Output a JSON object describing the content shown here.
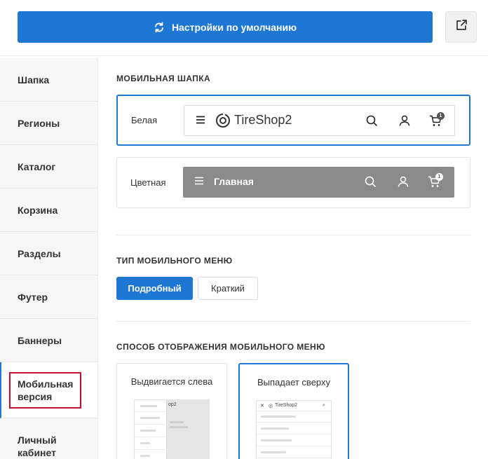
{
  "toolbar": {
    "reset_label": "Настройки по умолчанию",
    "reset_icon": "refresh-icon",
    "share_icon": "share-icon",
    "accent_color": "#1f77d4"
  },
  "sidebar": {
    "items": [
      {
        "label": "Шапка"
      },
      {
        "label": "Регионы"
      },
      {
        "label": "Каталог"
      },
      {
        "label": "Корзина"
      },
      {
        "label": "Разделы"
      },
      {
        "label": "Футер"
      },
      {
        "label": "Баннеры"
      },
      {
        "label": "Мобильная версия",
        "line1": "Мобильная",
        "line2": "версия",
        "active": true
      },
      {
        "label": "Личный кабинет",
        "line1": "Личный",
        "line2": "кабинет"
      }
    ]
  },
  "mobile_header": {
    "title": "МОБИЛЬНАЯ ШАПКА",
    "options": [
      {
        "label": "Белая",
        "selected": true,
        "preview_logo": "TireShop2",
        "cart_count": "1"
      },
      {
        "label": "Цветная",
        "selected": false,
        "preview_title": "Главная",
        "cart_count": "1",
        "color": "#8a8a8a"
      }
    ]
  },
  "menu_type": {
    "title": "ТИП МОБИЛЬНОГО МЕНЮ",
    "options": [
      {
        "label": "Подробный",
        "selected": true
      },
      {
        "label": "Краткий",
        "selected": false
      }
    ]
  },
  "menu_display": {
    "title": "СПОСОБ ОТОБРАЖЕНИЯ МОБИЛЬНОГО МЕНЮ",
    "options": [
      {
        "label": "Выдвигается слева",
        "selected": false,
        "preview_text": "op2"
      },
      {
        "label": "Выпадает сверху",
        "selected": true,
        "preview_text": "TireShop2"
      }
    ]
  }
}
